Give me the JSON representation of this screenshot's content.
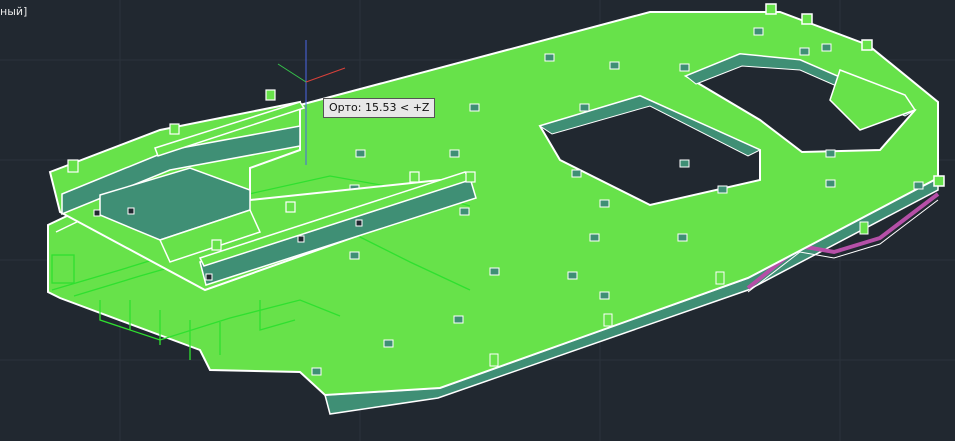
{
  "viewport": {
    "label": "ный]",
    "background_color": "#212830"
  },
  "tracking_tooltip": {
    "mode": "Орто",
    "value": "15.53",
    "direction": "< +Z"
  },
  "colors": {
    "solid_fill": "#67e24a",
    "solid_edge": "#ffffff",
    "side_face": "#3f8f75",
    "wire_green": "#2fe02f",
    "selected_edge": "#b54fa7",
    "axis_x": "#d8403a",
    "axis_y": "#36c24a",
    "axis_z": "#4a66e6"
  },
  "icons": {
    "ucs": "ucs-crosshair-icon"
  }
}
